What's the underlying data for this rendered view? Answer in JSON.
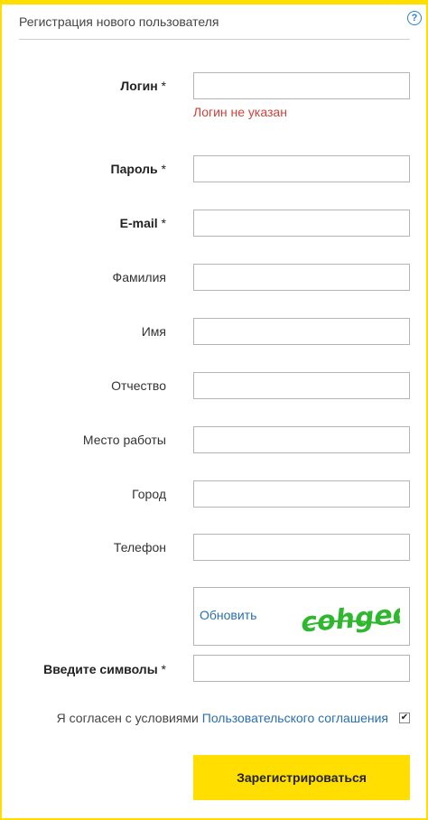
{
  "header": {
    "title": "Регистрация нового пользователя",
    "help_icon": "?"
  },
  "form": {
    "login": {
      "label": "Логин",
      "required_mark": " *",
      "value": "",
      "error": "Логин не указан"
    },
    "password": {
      "label": "Пароль",
      "required_mark": " *",
      "value": ""
    },
    "email": {
      "label": "E-mail",
      "required_mark": " *",
      "value": ""
    },
    "last_name": {
      "label": "Фамилия",
      "value": ""
    },
    "first_name": {
      "label": "Имя",
      "value": ""
    },
    "middle_name": {
      "label": "Отчество",
      "value": ""
    },
    "workplace": {
      "label": "Место работы",
      "value": ""
    },
    "city": {
      "label": "Город",
      "value": ""
    },
    "phone": {
      "label": "Телефон",
      "value": ""
    },
    "captcha": {
      "refresh_label": "Обновить",
      "image_text": "cohged",
      "label": "Введите символы",
      "required_mark": " *",
      "value": ""
    }
  },
  "agreement": {
    "text": "Я согласен с условиями ",
    "link": "Пользовательского соглашения",
    "checked": true
  },
  "submit": {
    "label": "Зарегистрироваться"
  },
  "colors": {
    "accent": "#ffde00",
    "error": "#d0413a",
    "link": "#2a6fb0",
    "captcha_green": "#2fb82f"
  }
}
